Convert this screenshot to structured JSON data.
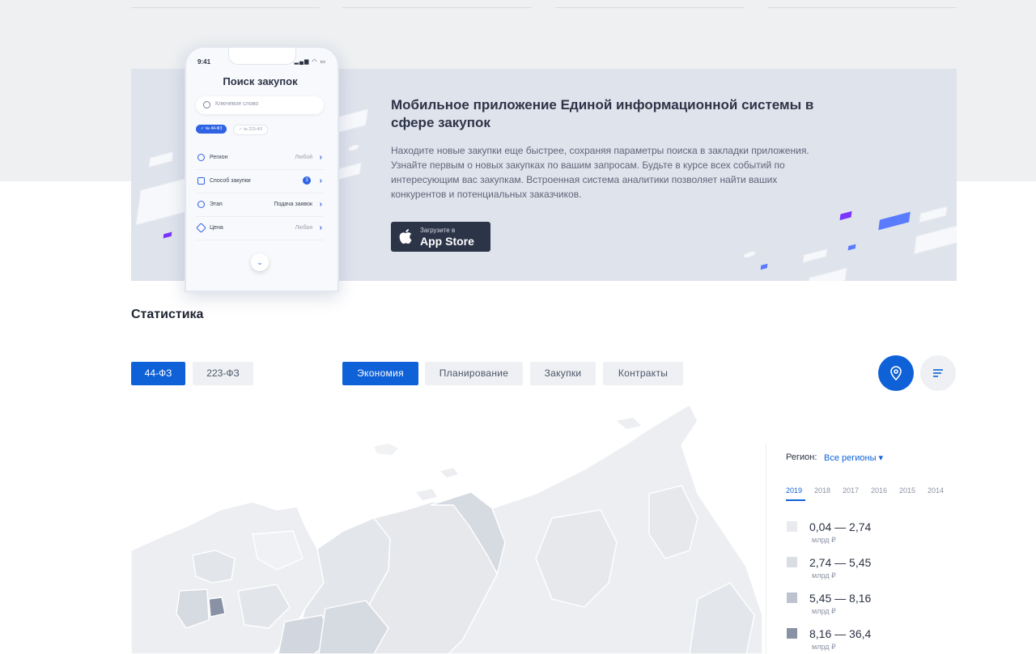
{
  "promo": {
    "title": "Мобильное приложение Единой информационной системы в сфере закупок",
    "text": "Находите новые закупки еще быстрее, сохраняя параметры поиска в закладки приложения. Узнайте первым о новых закупках по вашим запросам. Будьте в курсе всех событий по интересующим вас закупкам. Встроенная система аналитики позволяет найти ваших конкурентов и потенциальных заказчиков.",
    "appstore_small": "Загрузите в",
    "appstore_big": "App Store"
  },
  "phone": {
    "time": "9:41",
    "status": "▂▄▆ ◠ ▭",
    "title": "Поиск закупок",
    "search_placeholder": "Ключевое слово",
    "chip_active": "✓ № 44-ФЗ",
    "chip_inactive": "✓ № 223-ФЗ",
    "rows": [
      {
        "label": "Регион",
        "value": "Любой"
      },
      {
        "label": "Способ закупки",
        "value": "",
        "count": "3"
      },
      {
        "label": "Этап",
        "value": "Подача заявок"
      },
      {
        "label": "Цена",
        "value": "Любая"
      }
    ],
    "chevron": "›",
    "down": "⌄"
  },
  "stats": {
    "title": "Статистика",
    "laws": [
      "44-ФЗ",
      "223-ФЗ"
    ],
    "tabs": [
      "Экономия",
      "Планирование",
      "Закупки",
      "Контракты"
    ]
  },
  "legend": {
    "region_label": "Регион:",
    "region_value": "Все регионы ▾",
    "years": [
      "2019",
      "2018",
      "2017",
      "2016",
      "2015",
      "2014"
    ],
    "ranges": [
      {
        "range": "0,04 — 2,74",
        "unit": "млрд ₽",
        "color": "#e8eaee"
      },
      {
        "range": "2,74 — 5,45",
        "unit": "млрд ₽",
        "color": "#dadde3"
      },
      {
        "range": "5,45 — 8,16",
        "unit": "млрд ₽",
        "color": "#bcc2ce"
      },
      {
        "range": "8,16 — 36,4",
        "unit": "млрд ₽",
        "color": "#8992a4"
      }
    ]
  },
  "colors": {
    "accent": "#0f61d8",
    "banner": "#dfe3ec",
    "map_light": "#eceef1",
    "map_mid": "#d6dae1",
    "map_dark": "#8992a4"
  }
}
